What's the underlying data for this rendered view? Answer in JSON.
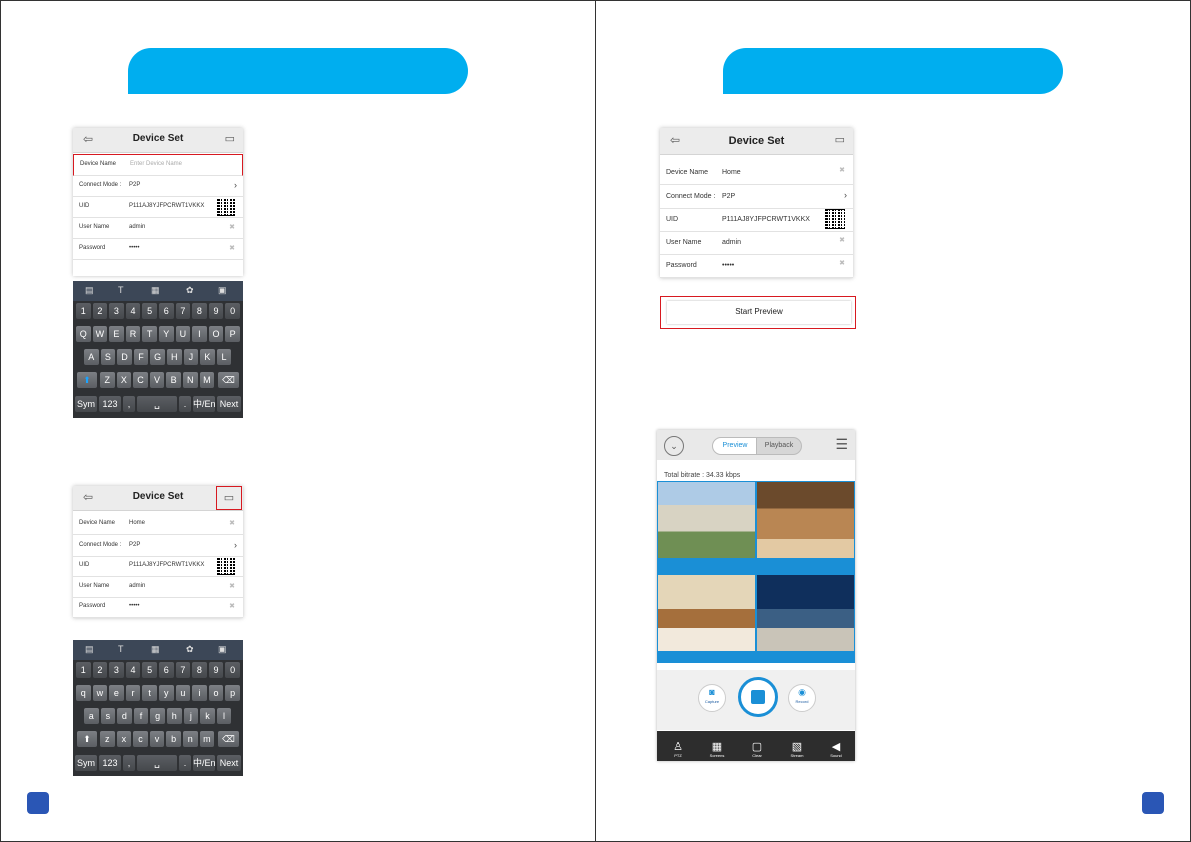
{
  "colors": {
    "banner": "#00AEEF",
    "page_badge": "#2A56B5",
    "highlight": "#d71920"
  },
  "device_set": {
    "title": "Device Set",
    "labels": {
      "device_name": "Device Name",
      "connect_mode": "Connect Mode :",
      "uid": "UID",
      "user_name": "User Name",
      "password": "Password"
    },
    "empty": {
      "device_name_placeholder": "Enter Device Name",
      "connect_mode": "P2P",
      "uid": "P111AJ8YJFPCRWT1VKKX",
      "user_name": "admin",
      "password": "•••••"
    },
    "filled": {
      "device_name": "Home",
      "connect_mode": "P2P",
      "uid": "P111AJ8YJFPCRWT1VKKX",
      "user_name": "admin",
      "password": "•••••"
    }
  },
  "keyboard_upper": {
    "numbers": [
      "1",
      "2",
      "3",
      "4",
      "5",
      "6",
      "7",
      "8",
      "9",
      "0"
    ],
    "row1": [
      "Q",
      "W",
      "E",
      "R",
      "T",
      "Y",
      "U",
      "I",
      "O",
      "P"
    ],
    "row2": [
      "A",
      "S",
      "D",
      "F",
      "G",
      "H",
      "J",
      "K",
      "L"
    ],
    "row3": [
      "Z",
      "X",
      "C",
      "V",
      "B",
      "N",
      "M"
    ],
    "bottom": {
      "sym": "Sym",
      "num": "123",
      "comma": ",",
      "period": ".",
      "lang": "中/En",
      "next": "Next"
    }
  },
  "keyboard_lower": {
    "row1": [
      "q",
      "w",
      "e",
      "r",
      "t",
      "y",
      "u",
      "i",
      "o",
      "p"
    ],
    "row2": [
      "a",
      "s",
      "d",
      "f",
      "g",
      "h",
      "j",
      "k",
      "l"
    ],
    "row3": [
      "z",
      "x",
      "c",
      "v",
      "b",
      "n",
      "m"
    ]
  },
  "start_preview": "Start Preview",
  "preview_screen": {
    "tab_preview": "Preview",
    "tab_playback": "Playback",
    "bitrate": "Total bitrate : 34.33 kbps",
    "capture": "Capture",
    "record": "Record",
    "bottom_bar": [
      "PTZ",
      "Screens",
      "Clear",
      "Stream",
      "Sound"
    ]
  }
}
